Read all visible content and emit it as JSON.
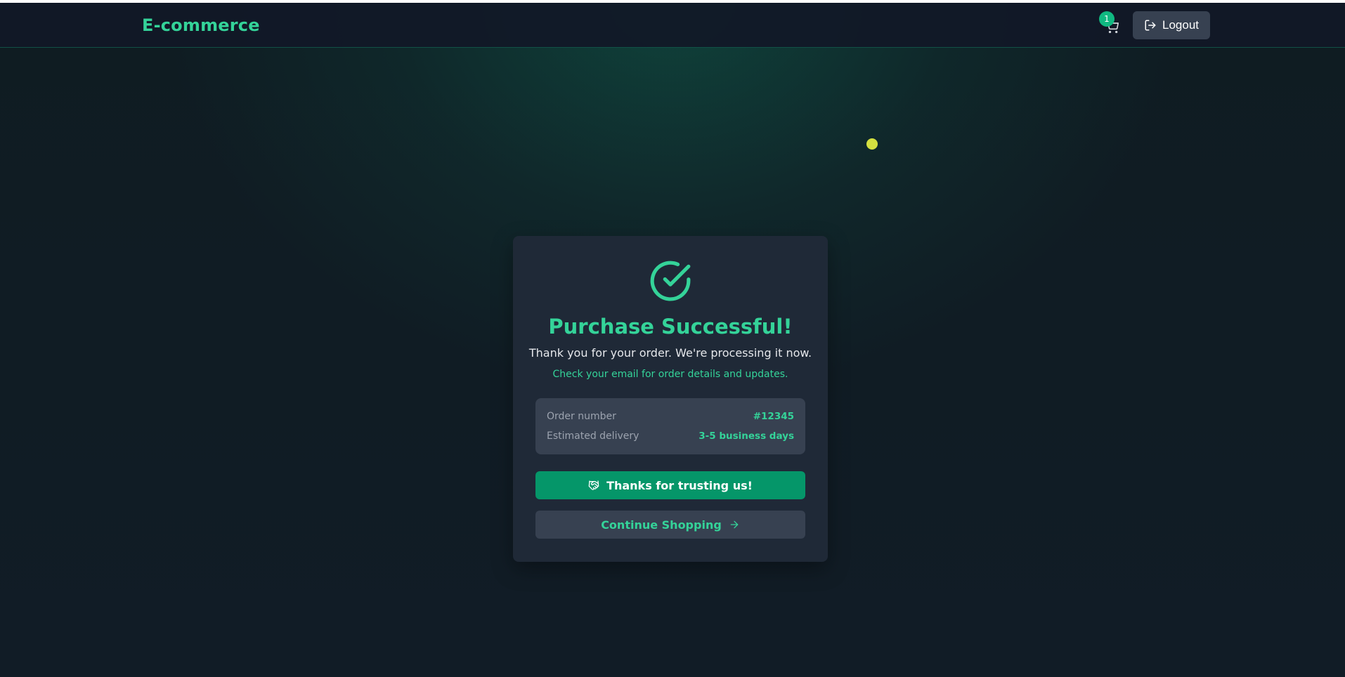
{
  "header": {
    "brand": "E-commerce",
    "cart_count": "1",
    "logout_label": "Logout"
  },
  "success": {
    "title": "Purchase Successful!",
    "subtitle": "Thank you for your order. We're processing it now.",
    "note": "Check your email for order details and updates."
  },
  "order": {
    "number_label": "Order number",
    "number_value": "#12345",
    "delivery_label": "Estimated delivery",
    "delivery_value": "3-5 business days"
  },
  "actions": {
    "thanks_label": "Thanks for trusting us!",
    "continue_label": "Continue Shopping"
  },
  "colors": {
    "accent": "#34d399",
    "primary_button": "#059669",
    "card": "#1f2937",
    "secondary": "#374151"
  },
  "icons": {
    "cart": "shopping-cart-icon",
    "logout": "logout-icon",
    "success": "check-circle-icon",
    "thanks": "handshake-icon",
    "continue": "arrow-right-icon"
  }
}
